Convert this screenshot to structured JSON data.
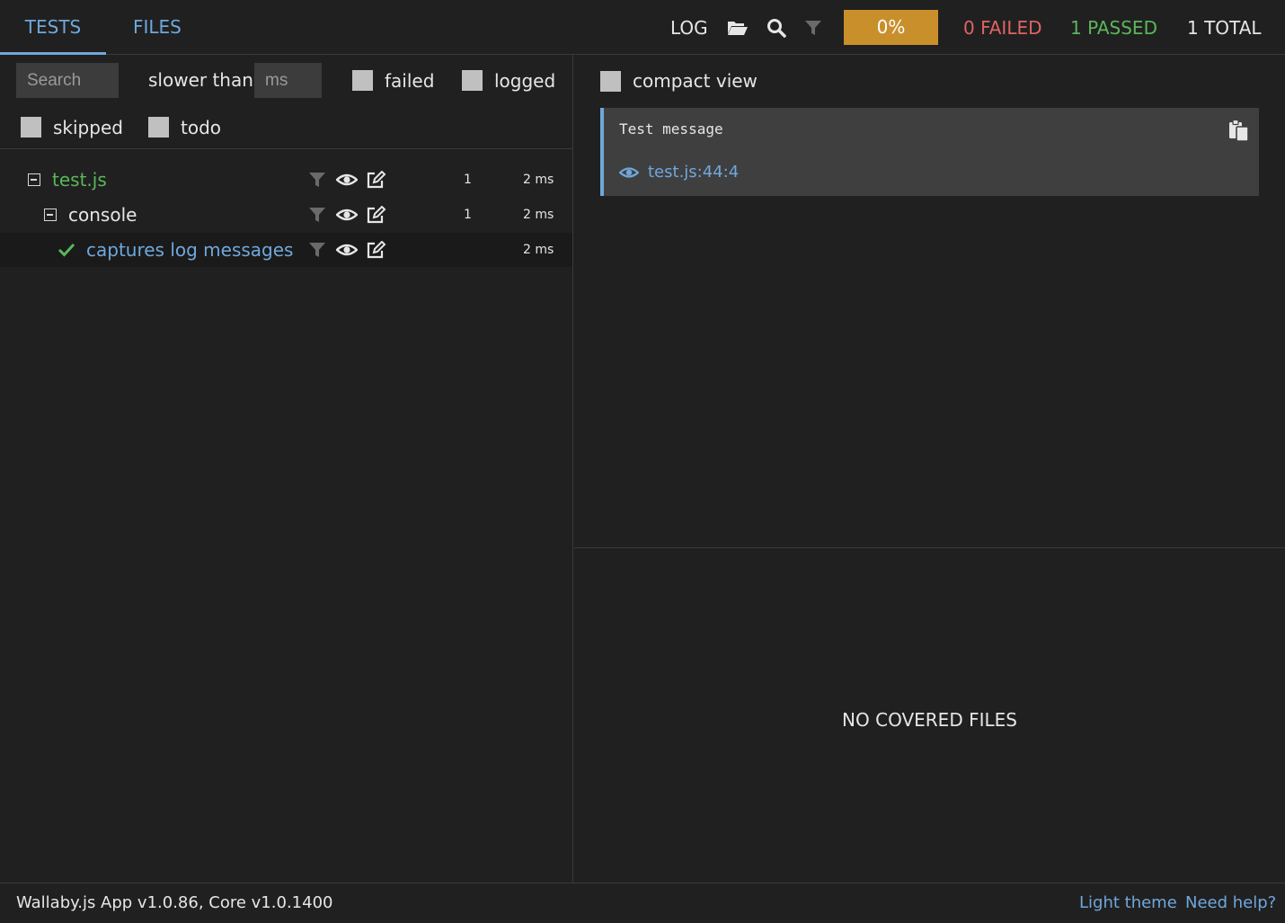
{
  "tabs": {
    "tests": "TESTS",
    "files": "FILES"
  },
  "toolbar": {
    "log": "LOG",
    "progress": "0%",
    "failed": "0 FAILED",
    "passed": "1 PASSED",
    "total": "1 TOTAL"
  },
  "filters": {
    "search_placeholder": "Search",
    "slower_than": "slower than",
    "ms_placeholder": "ms",
    "failed": "failed",
    "logged": "logged",
    "skipped": "skipped",
    "todo": "todo"
  },
  "tree": [
    {
      "name": "test.js",
      "count": "1",
      "time": "2 ms"
    },
    {
      "name": "console",
      "count": "1",
      "time": "2 ms"
    },
    {
      "name": "captures log messages",
      "count": "",
      "time": "2 ms"
    }
  ],
  "details": {
    "compact_view": "compact view",
    "message": "Test message",
    "location": "test.js:44:4",
    "no_covered": "NO COVERED FILES"
  },
  "footer": {
    "version": "Wallaby.js App v1.0.86, Core v1.0.1400",
    "light_theme": "Light theme",
    "need_help": "Need help?"
  },
  "colors": {
    "accent": "#6fa8dc",
    "failed": "#e06363",
    "passed": "#5ab75a",
    "progress": "#c98f2b"
  }
}
